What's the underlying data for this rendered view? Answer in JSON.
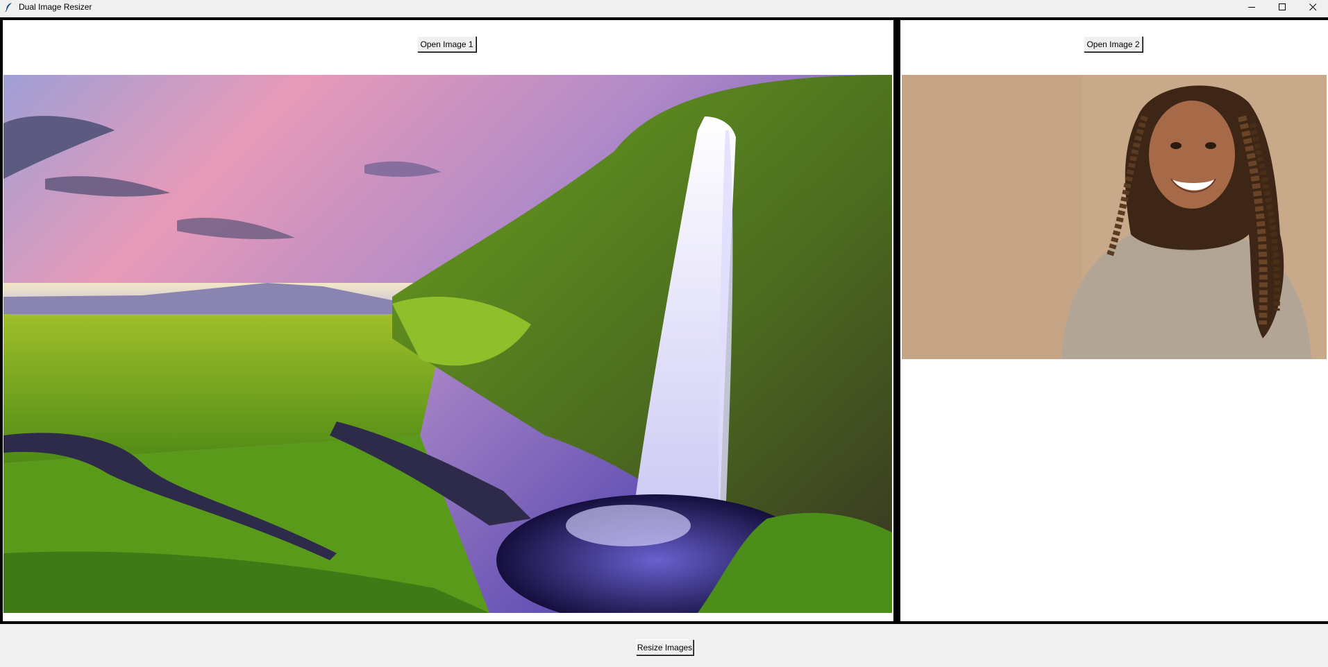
{
  "window": {
    "title": "Dual Image Resizer",
    "app_icon": "feather-icon",
    "controls": [
      "minimize-icon",
      "maximize-icon",
      "close-icon"
    ]
  },
  "left_panel": {
    "open_button_label": "Open Image 1",
    "image": "waterfall-landscape-photo"
  },
  "right_panel": {
    "open_button_label": "Open Image 2",
    "image": "smiling-girl-portrait-photo"
  },
  "footer": {
    "resize_button_label": "Resize Images"
  },
  "colors": {
    "window_bg": "#f0f0f0",
    "panel_border": "#000000",
    "panel_bg": "#ffffff"
  }
}
